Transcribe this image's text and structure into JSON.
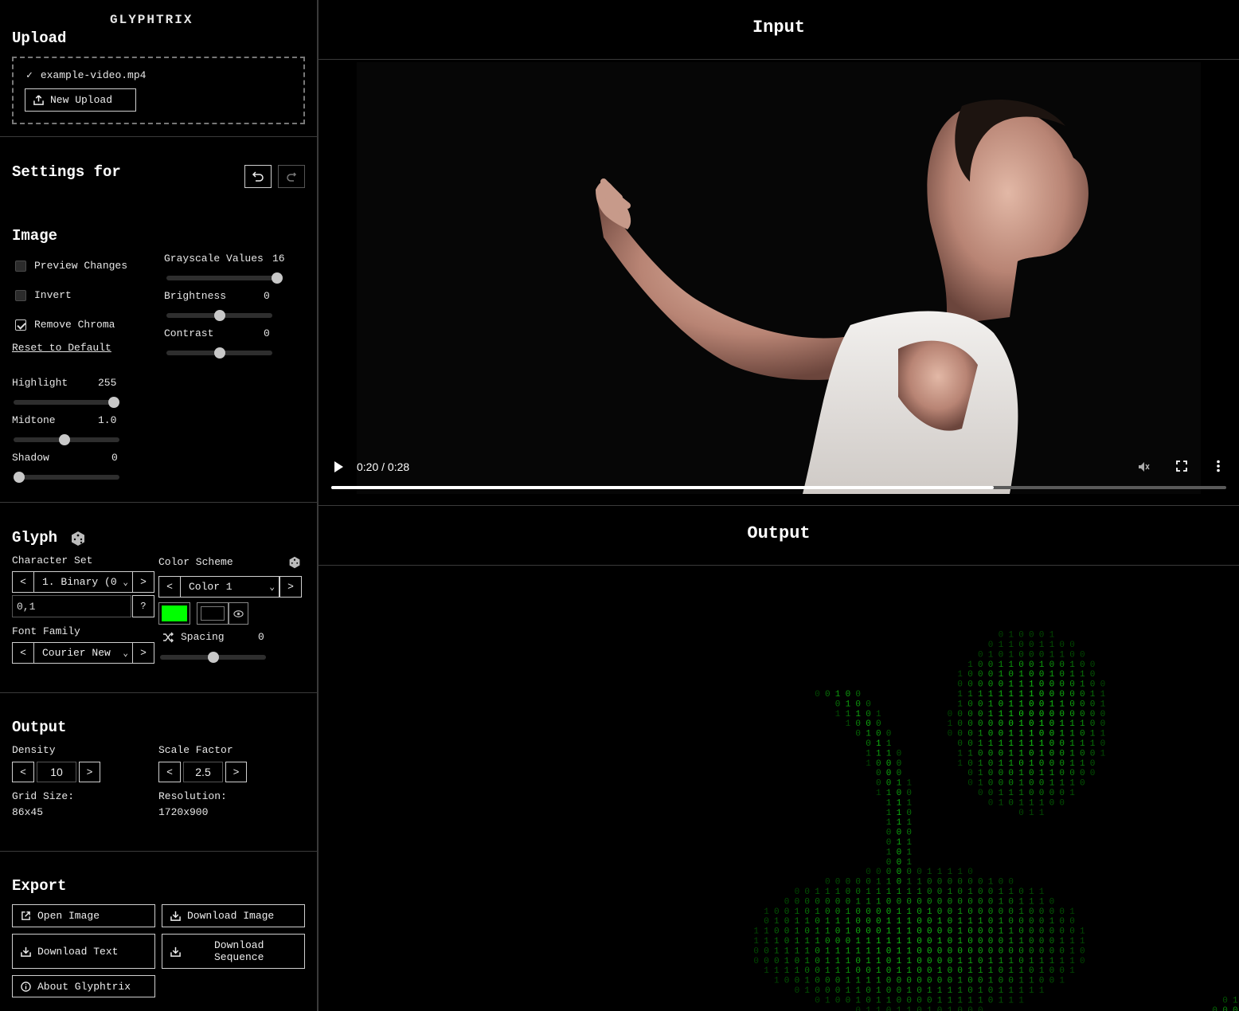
{
  "app_title": "GLYPHTRIX",
  "upload": {
    "heading": "Upload",
    "filename": "example-video.mp4",
    "new_upload": "New Upload"
  },
  "settings": {
    "heading": "Settings for"
  },
  "image": {
    "heading": "Image",
    "preview_changes": "Preview Changes",
    "invert": "Invert",
    "remove_chroma": "Remove Chroma",
    "reset": "Reset to Default",
    "grayscale_label": "Grayscale Values",
    "grayscale_value": "16",
    "grayscale_level": 1.0,
    "brightness_label": "Brightness",
    "brightness_value": "0",
    "brightness_level": 0.5,
    "contrast_label": "Contrast",
    "contrast_value": "0",
    "contrast_level": 0.5,
    "highlight_label": "Highlight",
    "highlight_value": "255",
    "highlight_level": 1.0,
    "midtone_label": "Midtone",
    "midtone_value": "1.0",
    "midtone_level": 0.48,
    "shadow_label": "Shadow",
    "shadow_value": "0",
    "shadow_level": 0.0,
    "checks": {
      "preview": false,
      "invert": false,
      "remove_chroma": true
    }
  },
  "glyph": {
    "heading": "Glyph",
    "charset_label": "Character Set",
    "charset_value": "1. Binary (0",
    "charset_chars": "0,1",
    "help": "?",
    "color_label": "Color Scheme",
    "color_value": "Color 1",
    "fg_color": "#00ff00",
    "bg_color": "#000000",
    "spacing_label": "Spacing",
    "spacing_value": "0",
    "spacing_level": 0.5,
    "font_label": "Font Family",
    "font_value": "Courier New",
    "prev": "<",
    "next": ">"
  },
  "output_settings": {
    "heading": "Output",
    "density_label": "Density",
    "density_value": "10",
    "scale_label": "Scale Factor",
    "scale_value": "2.5",
    "grid_label": "Grid Size:",
    "grid_value": "86x45",
    "res_label": "Resolution:",
    "res_value": "1720x900"
  },
  "export": {
    "heading": "Export",
    "open_image": "Open Image",
    "download_image": "Download Image",
    "download_text": "Download Text",
    "download_sequence_1": "Download",
    "download_sequence_2": "Sequence",
    "about": "About Glyphtrix"
  },
  "main": {
    "input_title": "Input",
    "output_title": "Output",
    "time": "0:20 / 0:28",
    "progress": 0.74
  }
}
